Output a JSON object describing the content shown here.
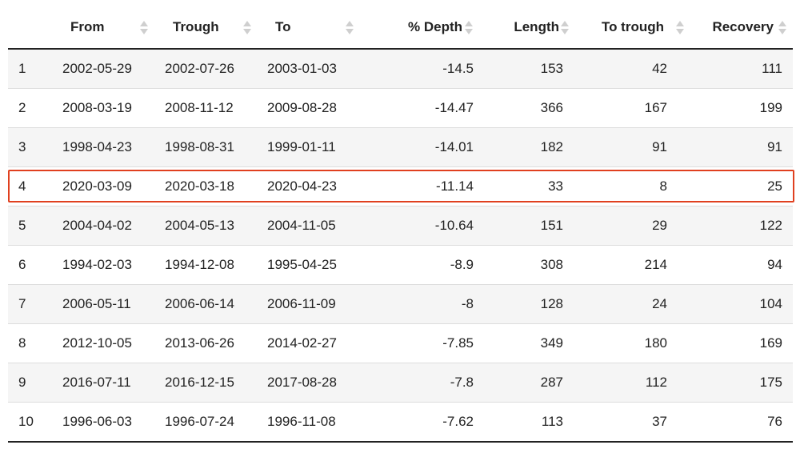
{
  "table": {
    "headers": [
      {
        "key": "idx",
        "label": ""
      },
      {
        "key": "from",
        "label": "From"
      },
      {
        "key": "trough",
        "label": "Trough"
      },
      {
        "key": "to",
        "label": "To"
      },
      {
        "key": "depth",
        "label": "% Depth"
      },
      {
        "key": "length",
        "label": "Length"
      },
      {
        "key": "to_trough",
        "label": "To trough"
      },
      {
        "key": "recovery",
        "label": "Recovery"
      }
    ],
    "rows": [
      {
        "idx": "1",
        "from": "2002-05-29",
        "trough": "2002-07-26",
        "to": "2003-01-03",
        "depth": "-14.5",
        "length": "153",
        "to_trough": "42",
        "recovery": "111"
      },
      {
        "idx": "2",
        "from": "2008-03-19",
        "trough": "2008-11-12",
        "to": "2009-08-28",
        "depth": "-14.47",
        "length": "366",
        "to_trough": "167",
        "recovery": "199"
      },
      {
        "idx": "3",
        "from": "1998-04-23",
        "trough": "1998-08-31",
        "to": "1999-01-11",
        "depth": "-14.01",
        "length": "182",
        "to_trough": "91",
        "recovery": "91"
      },
      {
        "idx": "4",
        "from": "2020-03-09",
        "trough": "2020-03-18",
        "to": "2020-04-23",
        "depth": "-11.14",
        "length": "33",
        "to_trough": "8",
        "recovery": "25"
      },
      {
        "idx": "5",
        "from": "2004-04-02",
        "trough": "2004-05-13",
        "to": "2004-11-05",
        "depth": "-10.64",
        "length": "151",
        "to_trough": "29",
        "recovery": "122"
      },
      {
        "idx": "6",
        "from": "1994-02-03",
        "trough": "1994-12-08",
        "to": "1995-04-25",
        "depth": "-8.9",
        "length": "308",
        "to_trough": "214",
        "recovery": "94"
      },
      {
        "idx": "7",
        "from": "2006-05-11",
        "trough": "2006-06-14",
        "to": "2006-11-09",
        "depth": "-8",
        "length": "128",
        "to_trough": "24",
        "recovery": "104"
      },
      {
        "idx": "8",
        "from": "2012-10-05",
        "trough": "2013-06-26",
        "to": "2014-02-27",
        "depth": "-7.85",
        "length": "349",
        "to_trough": "180",
        "recovery": "169"
      },
      {
        "idx": "9",
        "from": "2016-07-11",
        "trough": "2016-12-15",
        "to": "2017-08-28",
        "depth": "-7.8",
        "length": "287",
        "to_trough": "112",
        "recovery": "175"
      },
      {
        "idx": "10",
        "from": "1996-06-03",
        "trough": "1996-07-24",
        "to": "1996-11-08",
        "depth": "-7.62",
        "length": "113",
        "to_trough": "37",
        "recovery": "76"
      }
    ],
    "highlighted_row_index": 3,
    "highlight_color": "#e0401f",
    "sort_icon": "sort-both-icon"
  }
}
